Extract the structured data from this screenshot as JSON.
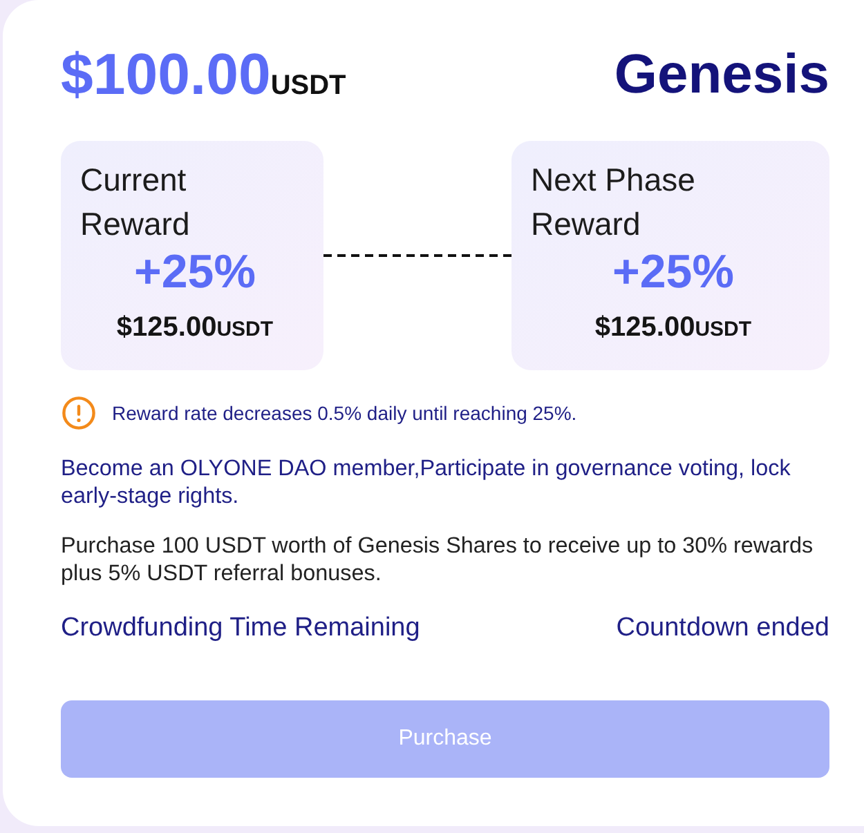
{
  "price": {
    "amount": "$100.00",
    "unit": "USDT"
  },
  "title": "Genesis",
  "phases": [
    {
      "label": "Current Reward",
      "bonus": "+25%",
      "amount": "$125.00",
      "unit": "USDT"
    },
    {
      "label": "Next Phase Reward",
      "bonus": "+25%",
      "amount": "$125.00",
      "unit": "USDT"
    }
  ],
  "notice": {
    "kind": "warning",
    "text": "Reward rate decreases 0.5% daily until reaching 25%."
  },
  "paragraphs": [
    {
      "kind": "highlight",
      "text": "Become an OLYONE DAO member,Participate in governance voting, lock early-stage rights."
    },
    {
      "kind": "plain",
      "text": "Purchase 100 USDT worth of Genesis Shares to receive up to 30% rewards plus 5% USDT referral bonuses."
    }
  ],
  "countdown": {
    "label": "Crowdfunding Time Remaining",
    "value": "Countdown ended"
  },
  "button": {
    "label": "Purchase",
    "disabled": true
  }
}
